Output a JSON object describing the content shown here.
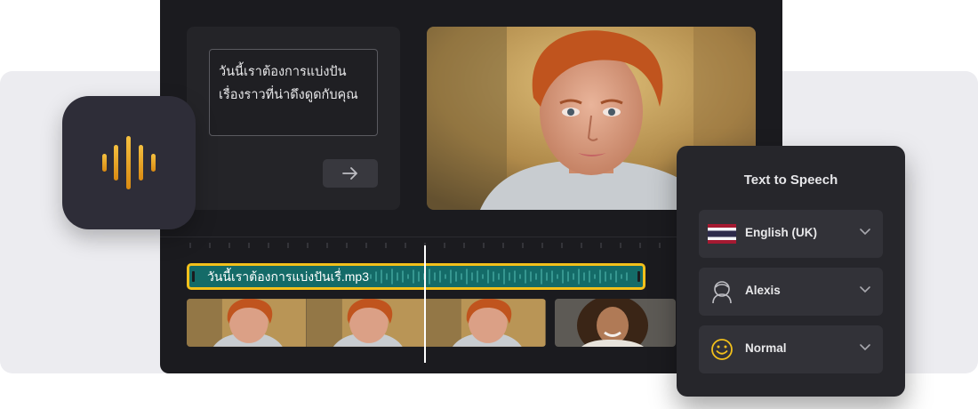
{
  "text_panel": {
    "text": "วันนี้เราต้องการแบ่งปันเรื่องราวที่น่าดึงดูดกับคุณ"
  },
  "timeline": {
    "audio_clip_name": "วันนี้เราต้องการแบ่งปันเรื่.mp3"
  },
  "tts_panel": {
    "title": "Text to Speech",
    "language": "English (UK)",
    "voice": "Alexis",
    "style": "Normal"
  },
  "colors": {
    "clip_fill": "#146b68",
    "clip_border": "#f2c01b",
    "icon_accent": "#e9a21d"
  }
}
